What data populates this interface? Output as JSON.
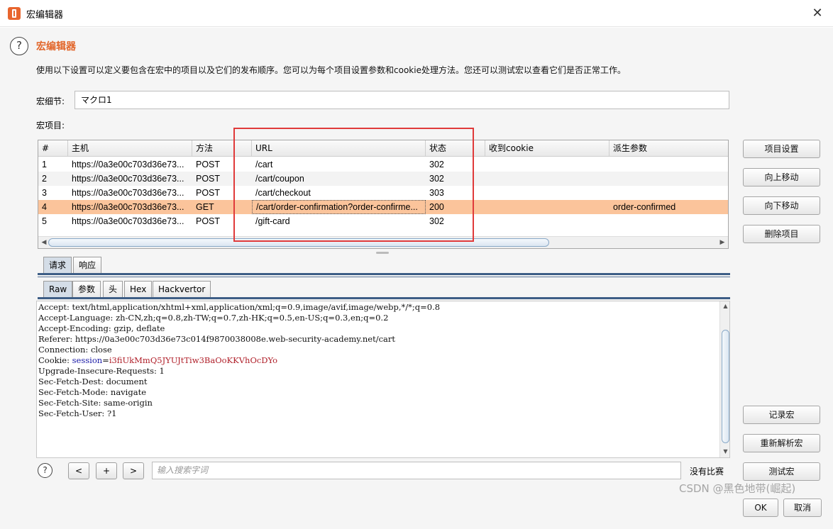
{
  "window": {
    "title": "宏编辑器",
    "close_glyph": "✕"
  },
  "header": {
    "title": "宏编辑器",
    "description": "使用以下设置可以定义要包含在宏中的项目以及它们的发布顺序。您可以为每个项目设置参数和cookie处理方法。您还可以测试宏以查看它们是否正常工作。",
    "help_glyph": "?"
  },
  "macro": {
    "detail_label": "宏细节:",
    "detail_value": "マクロ1",
    "items_label": "宏项目:"
  },
  "table": {
    "columns": [
      "#",
      "主机",
      "方法",
      "URL",
      "状态",
      "收到cookie",
      "派生参数"
    ],
    "rows": [
      {
        "num": "1",
        "host": "https://0a3e00c703d36e73...",
        "method": "POST",
        "url": "/cart",
        "status": "302",
        "cookie": "",
        "param": ""
      },
      {
        "num": "2",
        "host": "https://0a3e00c703d36e73...",
        "method": "POST",
        "url": "/cart/coupon",
        "status": "302",
        "cookie": "",
        "param": ""
      },
      {
        "num": "3",
        "host": "https://0a3e00c703d36e73...",
        "method": "POST",
        "url": "/cart/checkout",
        "status": "303",
        "cookie": "",
        "param": ""
      },
      {
        "num": "4",
        "host": "https://0a3e00c703d36e73...",
        "method": "GET",
        "url": "/cart/order-confirmation?order-confirme...",
        "status": "200",
        "cookie": "",
        "param": "order-confirmed"
      },
      {
        "num": "5",
        "host": "https://0a3e00c703d36e73...",
        "method": "POST",
        "url": "/gift-card",
        "status": "302",
        "cookie": "",
        "param": ""
      }
    ],
    "selected_row": 4
  },
  "side_buttons": {
    "item_settings": "项目设置",
    "move_up": "向上移动",
    "move_down": "向下移动",
    "delete_item": "删除项目",
    "record_macro": "记录宏",
    "reanalyze_macro": "重新解析宏",
    "test_macro": "测试宏"
  },
  "tabs": {
    "outer": [
      "请求",
      "响应"
    ],
    "inner": [
      "Raw",
      "参数",
      "头",
      "Hex",
      "Hackvertor"
    ]
  },
  "request": {
    "lines": [
      "Accept: text/html,application/xhtml+xml,application/xml;q=0.9,image/avif,image/webp,*/*;q=0.8",
      "Accept-Language: zh-CN,zh;q=0.8,zh-TW;q=0.7,zh-HK;q=0.5,en-US;q=0.3,en;q=0.2",
      "Accept-Encoding: gzip, deflate",
      "Referer: https://0a3e00c703d36e73c014f9870038008e.web-security-academy.net/cart",
      "Connection: close"
    ],
    "cookie_prefix": "Cookie: ",
    "cookie_name": "session",
    "cookie_value": "i3fiUkMmQ5JYUJtTiw3BaOoKKVhOcDYo",
    "lines_after": [
      "Upgrade-Insecure-Requests: 1",
      "Sec-Fetch-Dest: document",
      "Sec-Fetch-Mode: navigate",
      "Sec-Fetch-Site: same-origin",
      "Sec-Fetch-User: ?1"
    ]
  },
  "search": {
    "prev": "<",
    "add": "+",
    "next": ">",
    "placeholder": "输入搜索字词",
    "match_status": "没有比赛"
  },
  "footer": {
    "ok": "OK",
    "cancel": "取消"
  },
  "watermark": "CSDN @黑色地带(崛起)"
}
